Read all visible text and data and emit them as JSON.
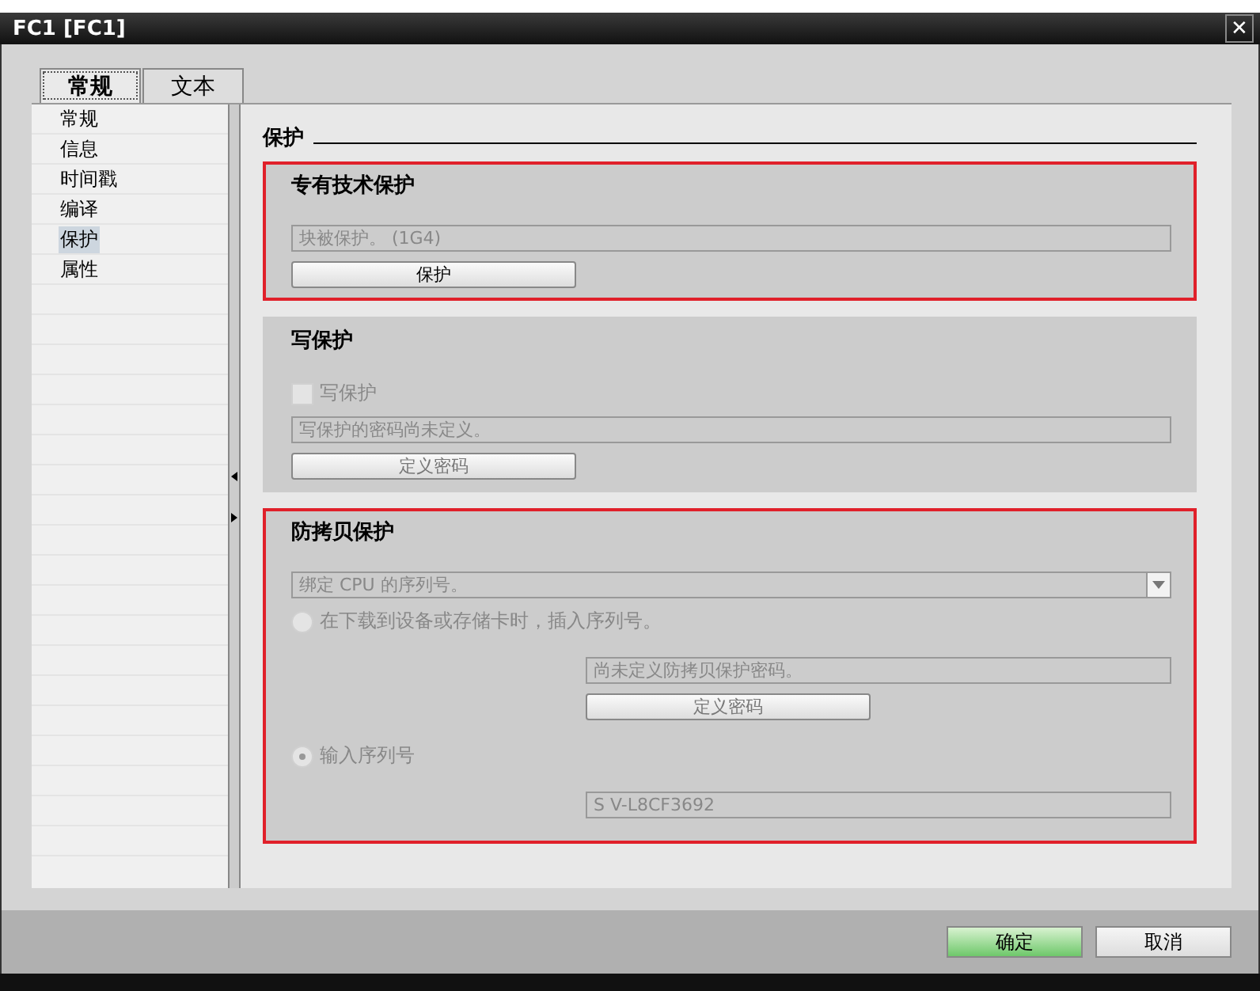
{
  "window": {
    "title": "FC1 [FC1]",
    "close": "✕"
  },
  "tabs": [
    {
      "label": "常规",
      "selected": true
    },
    {
      "label": "文本",
      "selected": false
    }
  ],
  "sidebar": {
    "items": [
      {
        "label": "常规",
        "selected": false
      },
      {
        "label": "信息",
        "selected": false
      },
      {
        "label": "时间戳",
        "selected": false
      },
      {
        "label": "编译",
        "selected": false
      },
      {
        "label": "保护",
        "selected": true
      },
      {
        "label": "属性",
        "selected": false
      }
    ]
  },
  "page_title": "保护",
  "sections": [
    {
      "title": "专有技术保护",
      "highlighted": true,
      "controls": [
        {
          "kind": "field",
          "value": "块被保护。 (1G4)"
        },
        {
          "kind": "button",
          "label": "保护",
          "disabled": false
        }
      ]
    },
    {
      "title": "写保护",
      "highlighted": false,
      "controls": [
        {
          "kind": "checkbox",
          "label": "写保护",
          "checked": false,
          "disabled": true
        },
        {
          "kind": "field",
          "value": "写保护的密码尚未定义。"
        },
        {
          "kind": "button",
          "label": "定义密码",
          "disabled": true
        }
      ]
    },
    {
      "title": "防拷贝保护",
      "highlighted": true,
      "controls": [
        {
          "kind": "dropdown",
          "value": "绑定 CPU 的序列号。"
        },
        {
          "kind": "radio",
          "label": "在下载到设备或存储卡时，插入序列号。",
          "selected": false,
          "disabled": true,
          "children": [
            {
              "kind": "field",
              "value": "尚未定义防拷贝保护密码。"
            },
            {
              "kind": "button",
              "label": "定义密码",
              "disabled": true
            }
          ]
        },
        {
          "kind": "radio",
          "label": "输入序列号",
          "selected": true,
          "disabled": true,
          "children": [
            {
              "kind": "field",
              "value": "S V-L8CF3692"
            }
          ]
        }
      ]
    }
  ],
  "buttons": [
    {
      "label": "确定",
      "primary": true
    },
    {
      "label": "取消",
      "primary": false
    }
  ]
}
